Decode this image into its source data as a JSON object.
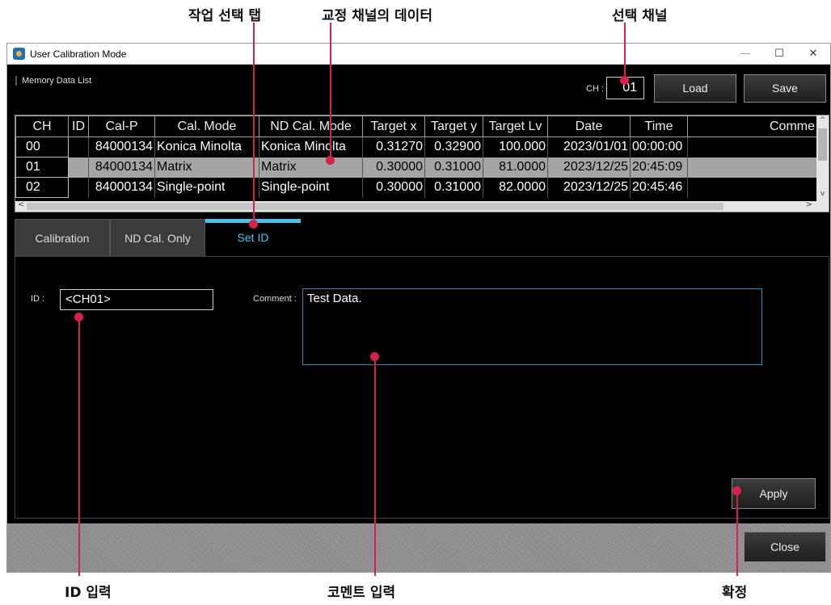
{
  "callouts": {
    "task_tab": "작업 선택 탭",
    "channel_data": "교정 채널의 데이터",
    "selected_channel": "선택 채널",
    "id_input": "ID 입력",
    "comment_input": "코멘트 입력",
    "confirm": "확정"
  },
  "window": {
    "title": "User Calibration Mode",
    "minimize": "—",
    "maximize": "☐",
    "close": "✕"
  },
  "memory_list_label": "Memory Data List",
  "channel": {
    "label": "CH :",
    "value": "01"
  },
  "buttons": {
    "load": "Load",
    "save": "Save",
    "apply": "Apply",
    "close": "Close"
  },
  "table": {
    "headers": [
      "CH",
      "ID",
      "Cal-P",
      "Cal. Mode",
      "ND Cal. Mode",
      "Target x",
      "Target y",
      "Target Lv",
      "Date",
      "Time",
      "Comme"
    ],
    "rows": [
      [
        "00",
        "",
        "84000134",
        "Konica Minolta",
        "Konica Minolta",
        "0.31270",
        "0.32900",
        "100.000",
        "2023/01/01",
        "00:00:00",
        ""
      ],
      [
        "01",
        "",
        "84000134",
        "Matrix",
        "Matrix",
        "0.30000",
        "0.31000",
        "81.0000",
        "2023/12/25",
        "20:45:09",
        ""
      ],
      [
        "02",
        "",
        "84000134",
        "Single-point",
        "Single-point",
        "0.30000",
        "0.31000",
        "82.0000",
        "2023/12/25",
        "20:45:46",
        ""
      ]
    ],
    "selected_row": 1
  },
  "tabs": [
    "Calibration",
    "ND Cal. Only",
    "Set ID"
  ],
  "active_tab": "Set ID",
  "form": {
    "id_label": "ID :",
    "id_value": "<CH01>",
    "comment_label": "Comment :",
    "comment_value": "Test Data."
  },
  "colors": {
    "callout_line": "#d4234a",
    "accent": "#4ac3ea",
    "selected_row": "#a5a5a5"
  }
}
